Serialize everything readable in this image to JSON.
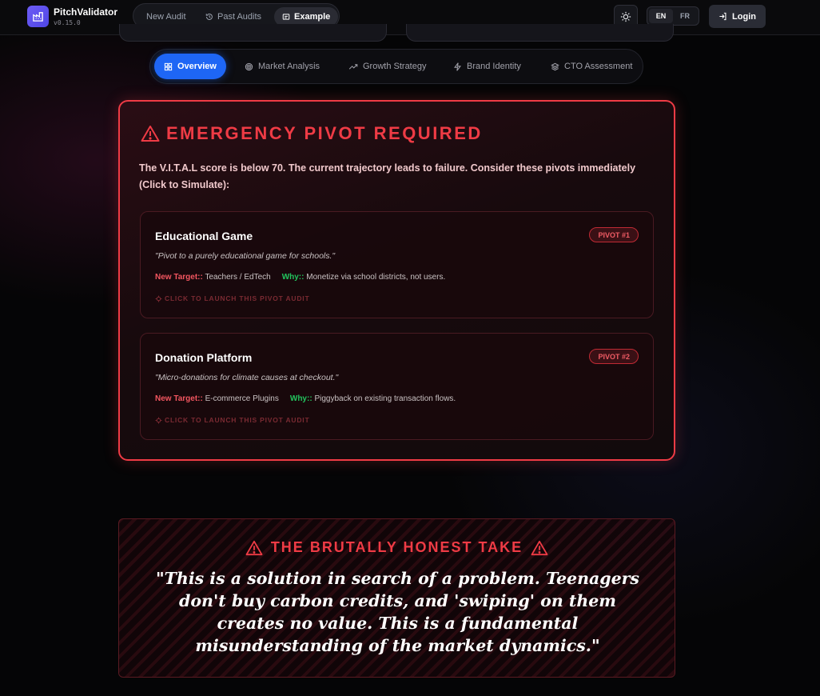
{
  "brand": {
    "name": "PitchValidator",
    "version": "v0.15.0"
  },
  "nav": [
    {
      "label": "New Audit",
      "icon": "none"
    },
    {
      "label": "Past Audits",
      "icon": "history-icon"
    },
    {
      "label": "Example",
      "icon": "file-icon",
      "active": true
    }
  ],
  "header": {
    "theme_icon": "sun-icon",
    "lang_en": "EN",
    "lang_fr": "FR",
    "login_label": "Login"
  },
  "tabs": [
    {
      "label": "Overview",
      "icon": "grid-icon",
      "active": true
    },
    {
      "label": "Market Analysis",
      "icon": "target-icon"
    },
    {
      "label": "Growth Strategy",
      "icon": "trend-icon"
    },
    {
      "label": "Brand Identity",
      "icon": "bolt-icon"
    },
    {
      "label": "CTO Assessment",
      "icon": "layers-icon"
    }
  ],
  "emergency": {
    "title": "EMERGENCY PIVOT REQUIRED",
    "description": "The V.I.T.A.L score is below 70. The current trajectory leads to failure. Consider these pivots immediately (Click to Simulate):",
    "pivots": [
      {
        "title": "Educational Game",
        "badge": "PIVOT #1",
        "quote": "\"Pivot to a purely educational game for schools.\"",
        "target_label": "New Target::",
        "target_value": "Teachers / EdTech",
        "why_label": "Why::",
        "why_value": "Monetize via school districts, not users.",
        "launch_label": "CLICK TO LAUNCH THIS PIVOT AUDIT"
      },
      {
        "title": "Donation Platform",
        "badge": "PIVOT #2",
        "quote": "\"Micro-donations for climate causes at checkout.\"",
        "target_label": "New Target::",
        "target_value": "E-commerce Plugins",
        "why_label": "Why::",
        "why_value": "Piggyback on existing transaction flows.",
        "launch_label": "CLICK TO LAUNCH THIS PIVOT AUDIT"
      }
    ]
  },
  "honest_take": {
    "title": "THE BRUTALLY HONEST TAKE",
    "quote": "\"This is a solution in search of a problem. Teenagers don't buy carbon credits, and 'swiping' on them creates no value. This is a fundamental misunderstanding of the market dynamics.\""
  },
  "colors": {
    "accent_red": "#ef3b45",
    "accent_blue": "#1e66f5",
    "accent_green": "#22c55e"
  }
}
